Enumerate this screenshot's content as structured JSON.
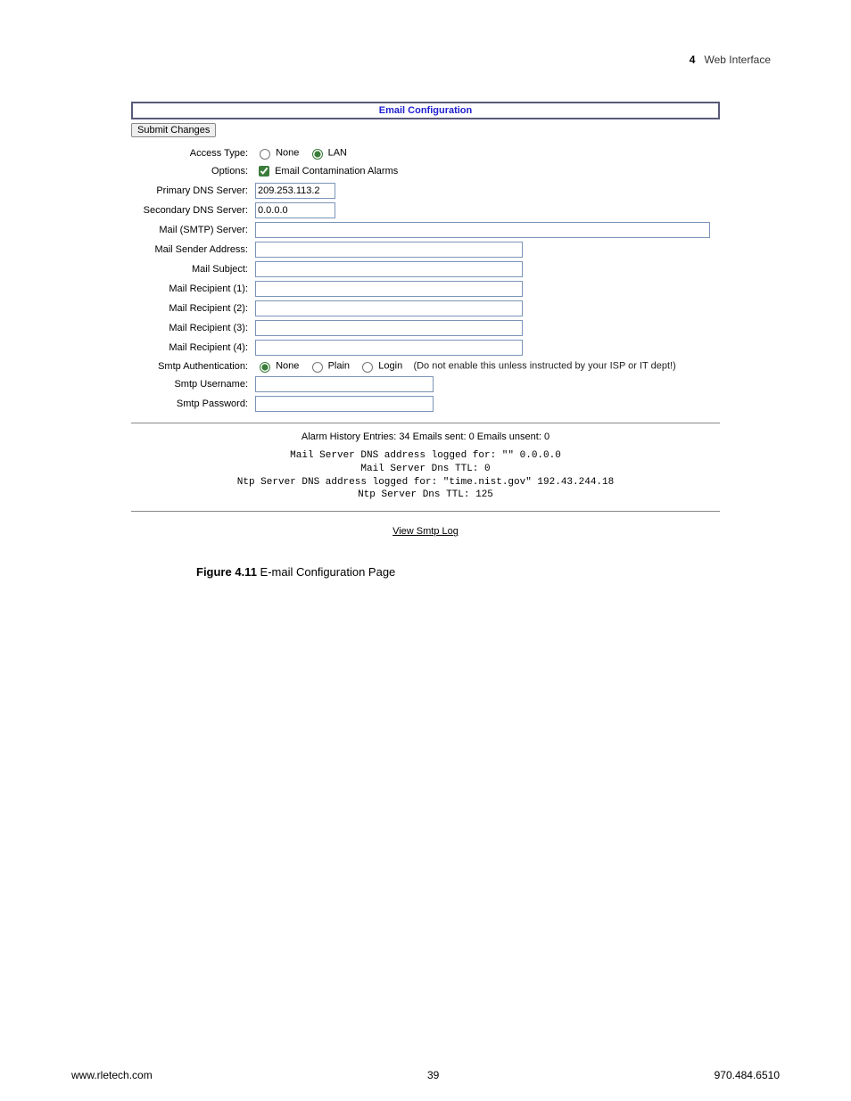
{
  "header": {
    "chapter_num": "4",
    "chapter_title": "Web Interface"
  },
  "panel": {
    "title": "Email Configuration",
    "submit_label": "Submit Changes",
    "rows": {
      "access_type": {
        "label": "Access Type:",
        "opt_none": "None",
        "opt_lan": "LAN"
      },
      "options": {
        "label": "Options:",
        "chk_label": "Email Contamination Alarms"
      },
      "primary_dns": {
        "label": "Primary DNS Server:",
        "value": "209.253.113.2"
      },
      "secondary_dns": {
        "label": "Secondary DNS Server:",
        "value": "0.0.0.0"
      },
      "smtp_server": {
        "label": "Mail (SMTP) Server:",
        "value": ""
      },
      "sender": {
        "label": "Mail Sender Address:",
        "value": ""
      },
      "subject": {
        "label": "Mail Subject:",
        "value": ""
      },
      "r1": {
        "label": "Mail Recipient (1):",
        "value": ""
      },
      "r2": {
        "label": "Mail Recipient (2):",
        "value": ""
      },
      "r3": {
        "label": "Mail Recipient (3):",
        "value": ""
      },
      "r4": {
        "label": "Mail Recipient (4):",
        "value": ""
      },
      "auth": {
        "label": "Smtp Authentication:",
        "opt_none": "None",
        "opt_plain": "Plain",
        "opt_login": "Login",
        "note": "(Do not enable this unless instructed by your ISP or IT dept!)"
      },
      "user": {
        "label": "Smtp Username:",
        "value": ""
      },
      "pass": {
        "label": "Smtp Password:",
        "value": ""
      }
    },
    "status_line": "Alarm History Entries: 34 Emails sent: 0 Emails unsent: 0",
    "status_pre_l1": "Mail Server DNS address logged for: \"\" 0.0.0.0",
    "status_pre_l2": "Mail Server Dns TTL: 0",
    "status_pre_l3": "Ntp Server DNS address logged for: \"time.nist.gov\" 192.43.244.18",
    "status_pre_l4": "Ntp Server Dns TTL: 125",
    "link_label": "View Smtp Log"
  },
  "caption": {
    "fig": "Figure 4.11",
    "text": " E-mail Configuration Page"
  },
  "footer": {
    "left": "www.rletech.com",
    "center": "39",
    "right": "970.484.6510"
  }
}
